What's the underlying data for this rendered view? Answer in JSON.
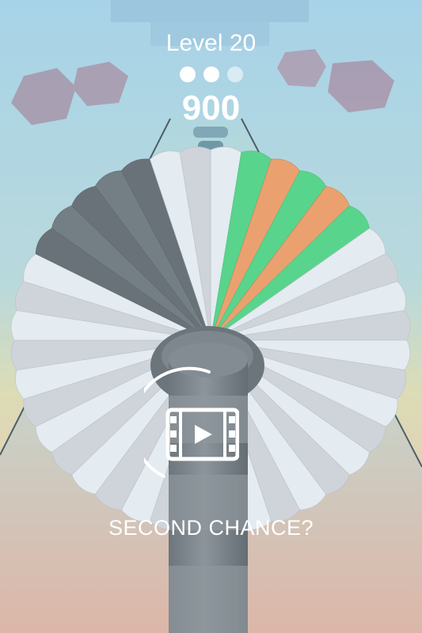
{
  "hud": {
    "level_label": "Level 20",
    "score": "900",
    "stage_progress": {
      "completed": 2,
      "total": 3
    }
  },
  "second_chance": {
    "prompt": "SECOND CHANCE?",
    "icon": "video-play-icon",
    "countdown_fraction": 0.4
  },
  "game": {
    "disk_colors": {
      "base": "#dde4ea",
      "danger": "#707b81",
      "green": "#5fe497",
      "orange": "#e39c6c"
    },
    "pole_color": "#7d868c",
    "sky_colors": [
      "#a9d5e7",
      "#d9ddb8",
      "#e8c0b2"
    ]
  }
}
